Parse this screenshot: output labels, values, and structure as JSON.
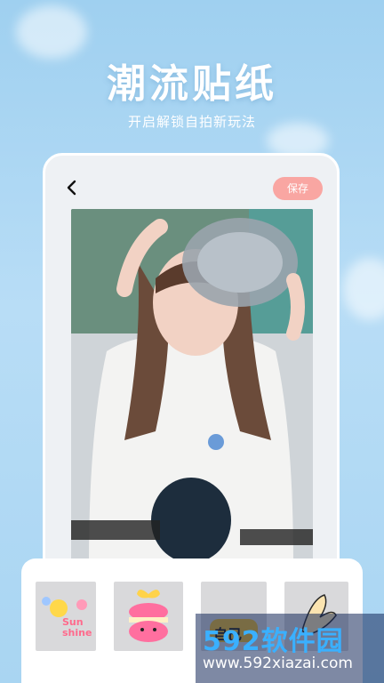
{
  "promo": {
    "title": "潮流贴纸",
    "subtitle": "开启解锁自拍新玩法"
  },
  "editor": {
    "back_icon": "chevron-left-icon",
    "save_label": "保存",
    "photo_alt": "Girl in white shirt wearing a helmet on a scooter"
  },
  "stickers": [
    {
      "name": "sun-shine",
      "text_line1": "Sun",
      "text_line2": "shine"
    },
    {
      "name": "gift-macaron"
    },
    {
      "name": "golden-badge",
      "text": "自己"
    },
    {
      "name": "fingers-doodle"
    }
  ],
  "watermark": {
    "brand": "592软件园",
    "url": "www.592xiazai.com"
  },
  "colors": {
    "sky": "#a9d5f2",
    "save_button": "#f9a6a2",
    "card": "#eef1f4",
    "watermark_brand": "#3ab0ff"
  }
}
